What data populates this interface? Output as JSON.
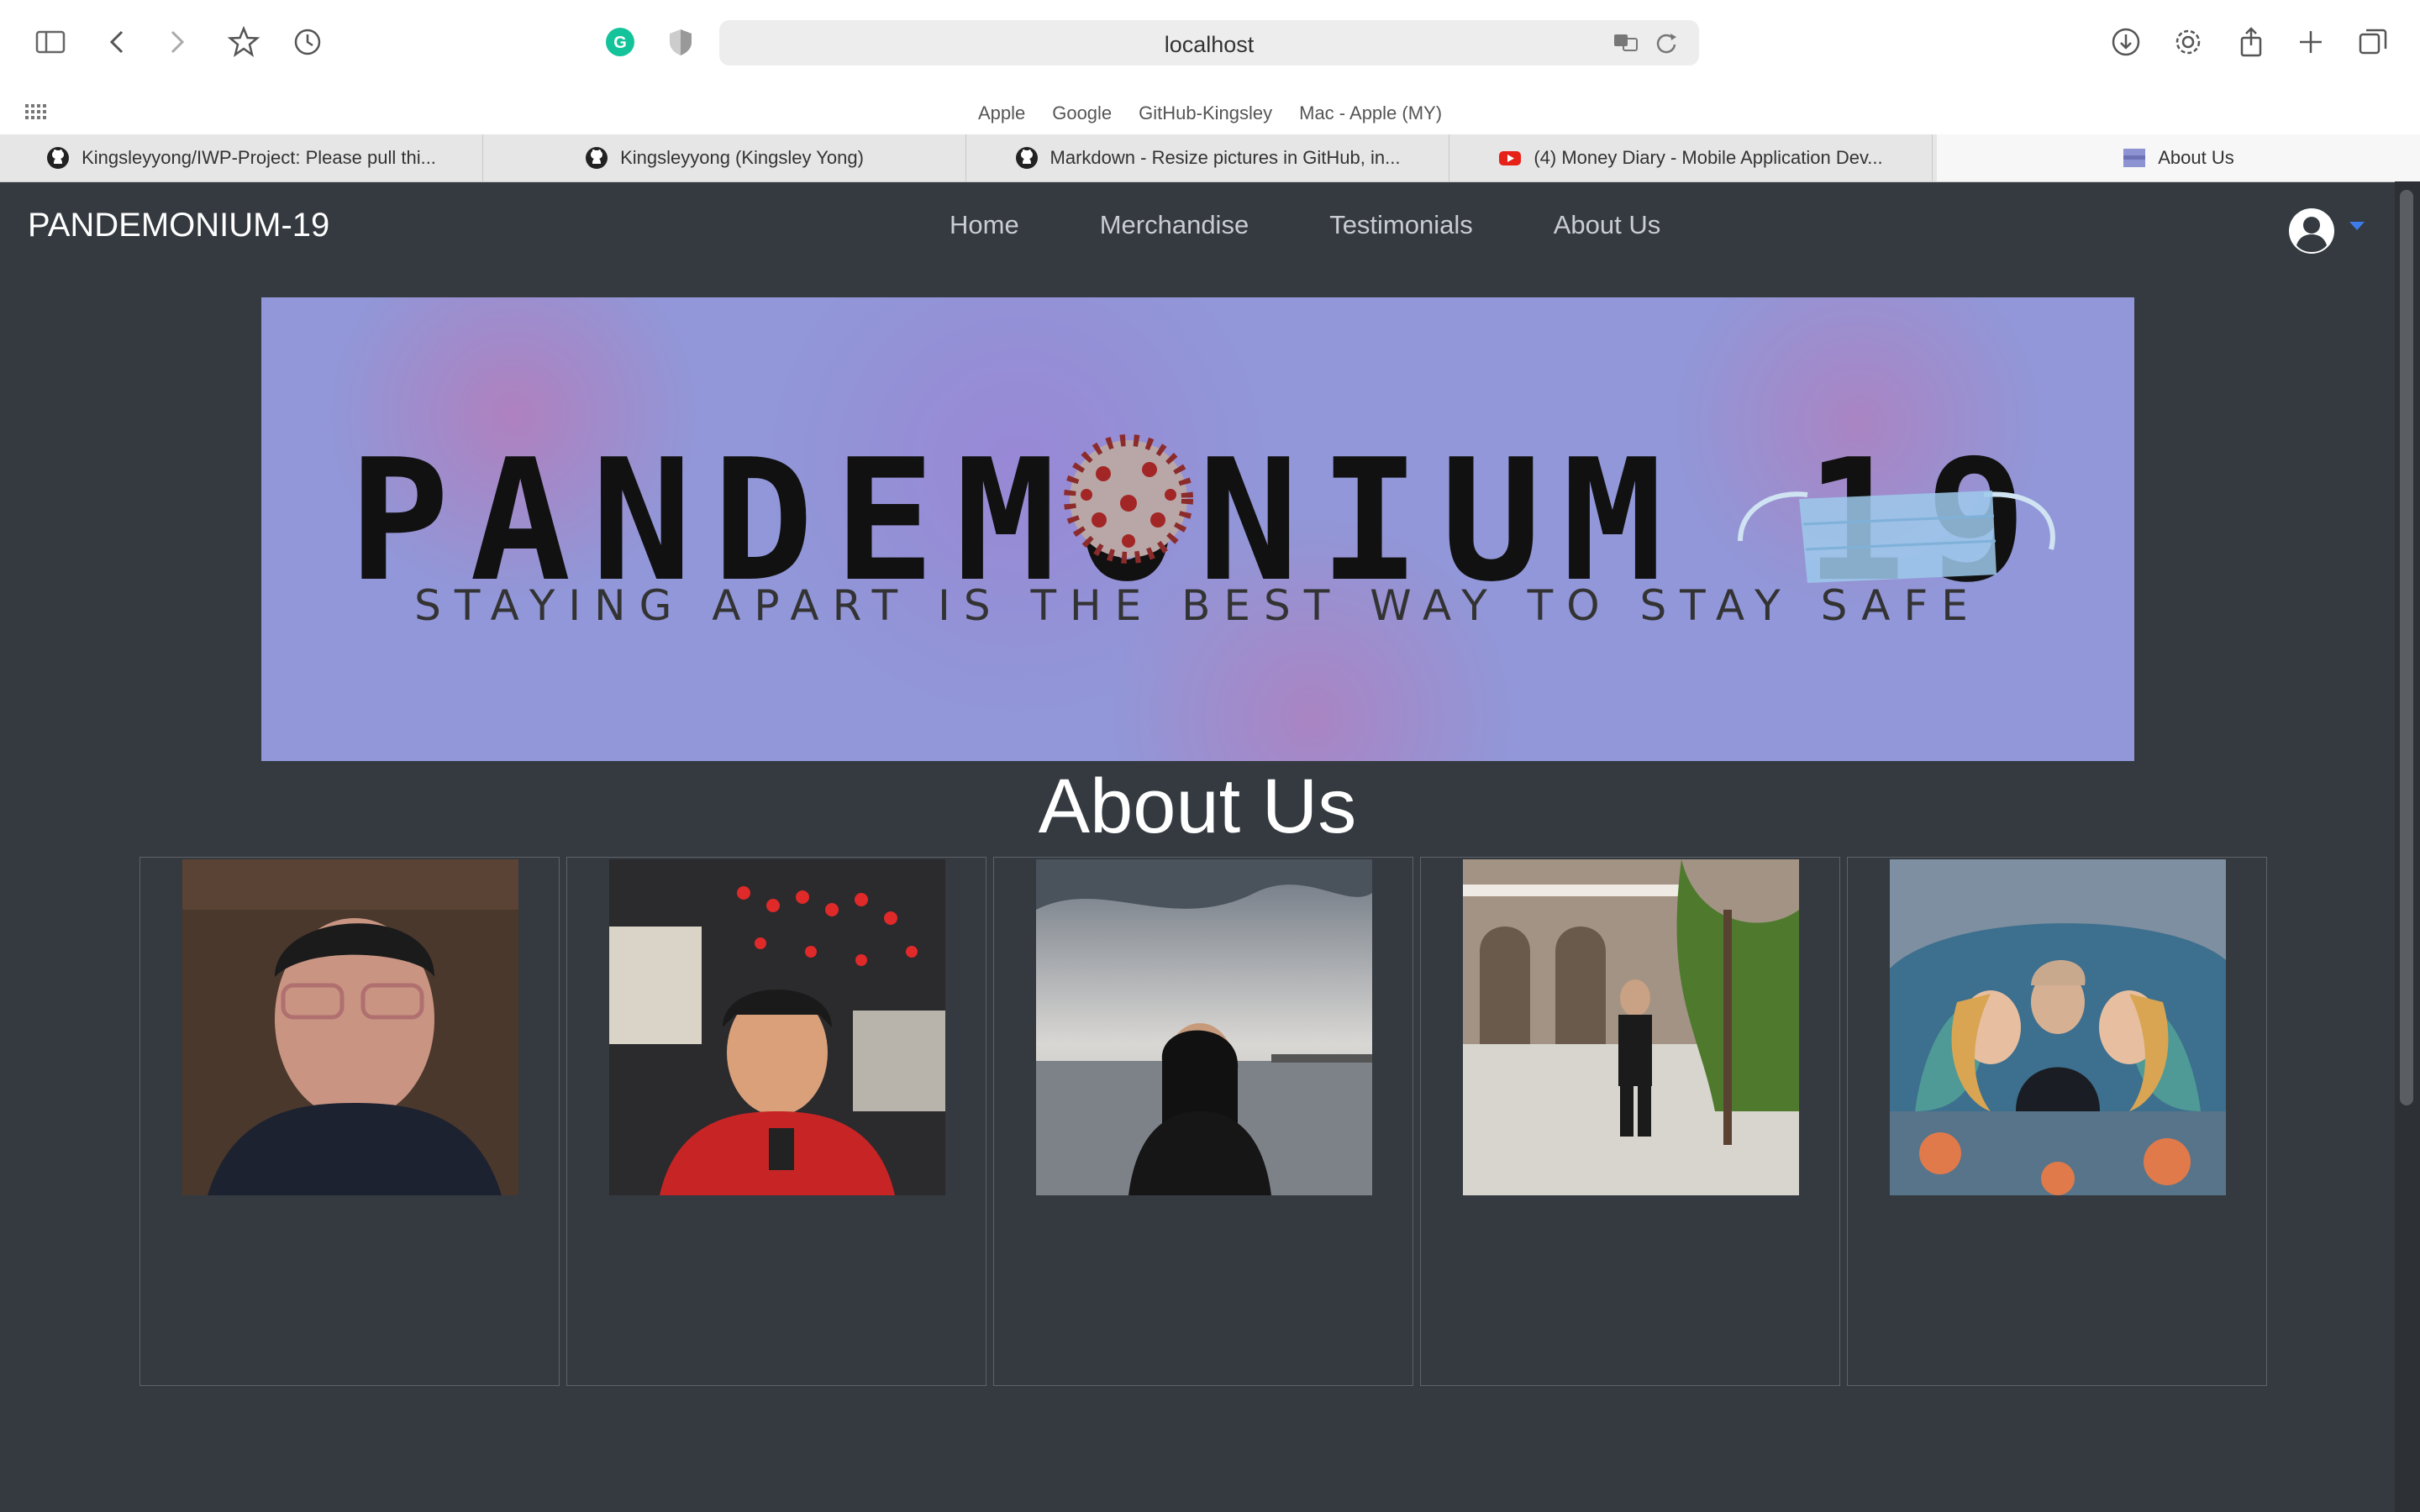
{
  "browser": {
    "url": "localhost",
    "bookmarks": [
      "Apple",
      "Google",
      "GitHub-Kingsley",
      "Mac - Apple (MY)"
    ],
    "tabs": [
      {
        "label": "Kingsleyyong/IWP-Project: Please pull thi...",
        "icon": "github-icon"
      },
      {
        "label": "Kingsleyyong (Kingsley Yong)",
        "icon": "github-icon"
      },
      {
        "label": "Markdown - Resize pictures in GitHub, in...",
        "icon": "github-icon"
      },
      {
        "label": "(4) Money Diary - Mobile Application Dev...",
        "icon": "youtube-icon"
      },
      {
        "label": "About Us",
        "icon": "site-favicon",
        "active": true
      }
    ]
  },
  "navbar": {
    "brand": "PANDEMONIUM-19",
    "links": [
      "Home",
      "Merchandise",
      "Testimonials",
      "About Us"
    ]
  },
  "banner": {
    "title": "PANDEMONIUM 19",
    "subtitle": "STAYING APART IS THE BEST WAY TO STAY SAFE"
  },
  "about": {
    "title": "About Us",
    "members": [
      {
        "photo": "member-photo-1"
      },
      {
        "photo": "member-photo-2"
      },
      {
        "photo": "member-photo-3"
      },
      {
        "photo": "member-photo-4"
      },
      {
        "photo": "member-photo-5"
      }
    ]
  },
  "colors": {
    "page_bg": "#343a40",
    "banner_bg": "#9197d8",
    "caret": "#3d7be8"
  }
}
